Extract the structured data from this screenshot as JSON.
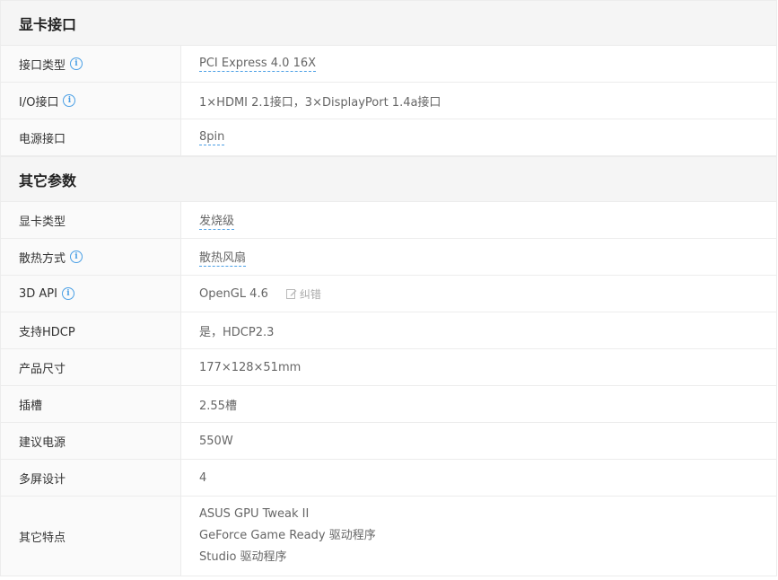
{
  "sections": [
    {
      "title": "显卡接口",
      "rows": [
        {
          "label": "接口类型",
          "value": "PCI Express 4.0 16X",
          "info": true,
          "link": true
        },
        {
          "label": "I/O接口",
          "value": "1×HDMI 2.1接口，3×DisplayPort 1.4a接口",
          "info": true,
          "link": false
        },
        {
          "label": "电源接口",
          "value": "8pin",
          "info": false,
          "link": true
        }
      ]
    },
    {
      "title": "其它参数",
      "rows": [
        {
          "label": "显卡类型",
          "value": "发烧级"
        },
        {
          "label": "散热方式",
          "value": "散热风扇"
        },
        {
          "label": "3D API",
          "value": "OpenGL 4.6",
          "correct_label": "纠错"
        },
        {
          "label": "支持HDCP",
          "value": "是，HDCP2.3"
        },
        {
          "label": "产品尺寸",
          "value": "177×128×51mm"
        },
        {
          "label": "插槽",
          "value": "2.55槽"
        },
        {
          "label": "建议电源",
          "value": "550W"
        },
        {
          "label": "多屏设计",
          "value": "4"
        },
        {
          "label": "其它特点",
          "lines": [
            "ASUS GPU Tweak II",
            "GeForce Game Ready 驱动程序",
            "Studio 驱动程序"
          ]
        }
      ]
    }
  ],
  "icons": {
    "info": "info-icon",
    "edit": "edit-icon"
  },
  "info_glyph": "i",
  "colors": {
    "accent": "#4a9fe5",
    "header_bg": "#f5f5f5",
    "border": "#ececec"
  }
}
